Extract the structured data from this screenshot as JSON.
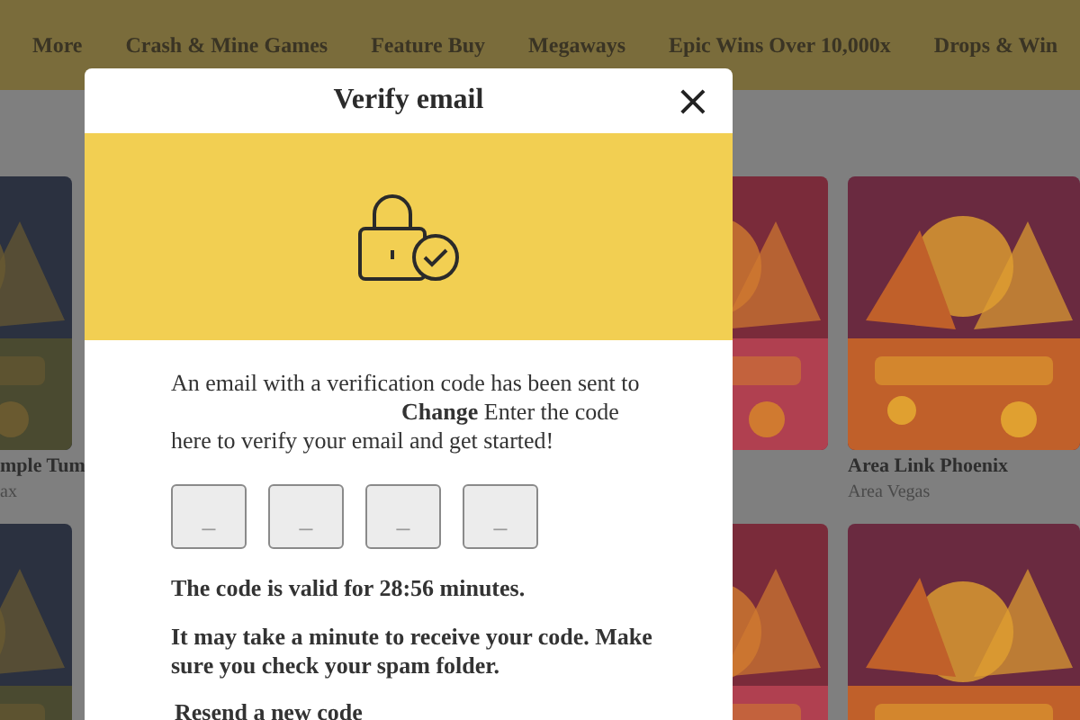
{
  "nav": {
    "items": [
      "More",
      "Crash & Mine Games",
      "Feature Buy",
      "Megaways",
      "Epic Wins Over 10,000x",
      "Drops & Win"
    ]
  },
  "game_rows": [
    [
      {
        "kind": "picture",
        "title": "mple Tum",
        "provider": "ax"
      },
      {
        "kind": "picture"
      },
      {
        "kind": "picture",
        "title": "Area Link Phoenix",
        "provider": "Area Vegas"
      }
    ],
    [
      {
        "kind": "picture"
      },
      {
        "kind": "picture"
      },
      {
        "kind": "picture"
      }
    ]
  ],
  "dialog": {
    "title": "Verify email",
    "close": "×",
    "message_start": "An email with a verification code has been sent to",
    "change_link": "Change",
    "message_end": "Enter the code here to verify your email and get started!",
    "code_fields": [
      {
        "placeholder": "_"
      },
      {
        "placeholder": "_"
      },
      {
        "placeholder": "_"
      },
      {
        "placeholder": "_"
      }
    ],
    "validity": "The code is valid for **28:56 minutes**.",
    "note": "It may take a minute to receive your code. Make sure you check your spam folder.",
    "resend": "Resend a new code"
  }
}
